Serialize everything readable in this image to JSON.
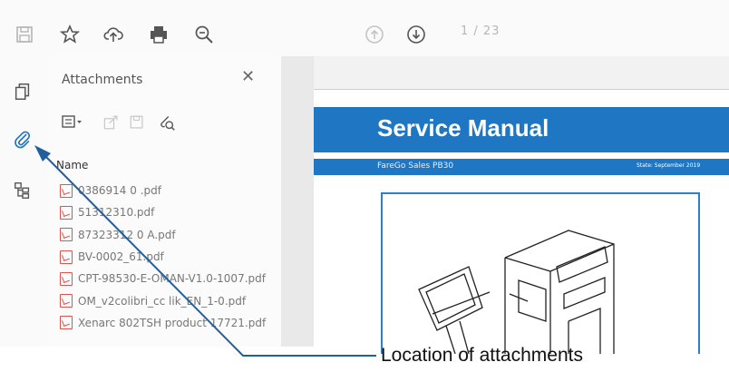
{
  "toolbar": {
    "page_indicator": "1 / 23",
    "icons": [
      "save-icon",
      "star-icon",
      "upload-cloud-icon",
      "print-icon",
      "zoom-out-icon",
      "page-up-icon",
      "page-down-icon"
    ]
  },
  "left_rail": {
    "icons": [
      "pages-icon",
      "paperclip-icon",
      "layers-icon"
    ]
  },
  "attachments_panel": {
    "title": "Attachments",
    "close_label": "✕",
    "column_header": "Name",
    "files": [
      "0386914 0 .pdf",
      "51312310.pdf",
      "87323312 0 A.pdf",
      "BV-0002_61.pdf",
      "CPT-98530-E-OMAN-V1.0-1007.pdf",
      "OM_v2colibri_cc lik_EN_1-0.pdf",
      "Xenarc 802TSH product 17721.pdf"
    ]
  },
  "document": {
    "title": "Service Manual",
    "subtitle": "FareGo Sales PB30",
    "status_text": "State: September 2019"
  },
  "callout": {
    "label": "Location of attachments",
    "arrow_color": "#1f5f9e"
  }
}
